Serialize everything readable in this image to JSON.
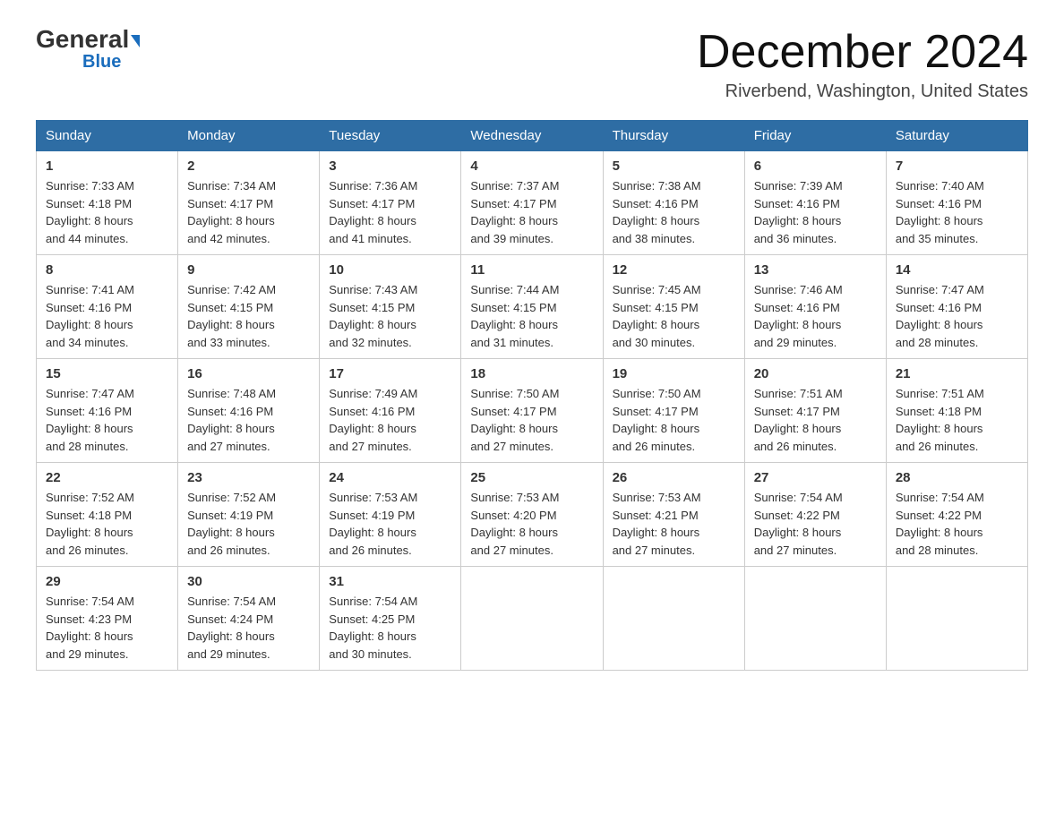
{
  "logo": {
    "line1_black": "General",
    "line1_blue": "Blue",
    "line2": "Blue"
  },
  "header": {
    "month_year": "December 2024",
    "location": "Riverbend, Washington, United States"
  },
  "days_of_week": [
    "Sunday",
    "Monday",
    "Tuesday",
    "Wednesday",
    "Thursday",
    "Friday",
    "Saturday"
  ],
  "weeks": [
    [
      {
        "day": "1",
        "sunrise": "7:33 AM",
        "sunset": "4:18 PM",
        "daylight": "8 hours and 44 minutes."
      },
      {
        "day": "2",
        "sunrise": "7:34 AM",
        "sunset": "4:17 PM",
        "daylight": "8 hours and 42 minutes."
      },
      {
        "day": "3",
        "sunrise": "7:36 AM",
        "sunset": "4:17 PM",
        "daylight": "8 hours and 41 minutes."
      },
      {
        "day": "4",
        "sunrise": "7:37 AM",
        "sunset": "4:17 PM",
        "daylight": "8 hours and 39 minutes."
      },
      {
        "day": "5",
        "sunrise": "7:38 AM",
        "sunset": "4:16 PM",
        "daylight": "8 hours and 38 minutes."
      },
      {
        "day": "6",
        "sunrise": "7:39 AM",
        "sunset": "4:16 PM",
        "daylight": "8 hours and 36 minutes."
      },
      {
        "day": "7",
        "sunrise": "7:40 AM",
        "sunset": "4:16 PM",
        "daylight": "8 hours and 35 minutes."
      }
    ],
    [
      {
        "day": "8",
        "sunrise": "7:41 AM",
        "sunset": "4:16 PM",
        "daylight": "8 hours and 34 minutes."
      },
      {
        "day": "9",
        "sunrise": "7:42 AM",
        "sunset": "4:15 PM",
        "daylight": "8 hours and 33 minutes."
      },
      {
        "day": "10",
        "sunrise": "7:43 AM",
        "sunset": "4:15 PM",
        "daylight": "8 hours and 32 minutes."
      },
      {
        "day": "11",
        "sunrise": "7:44 AM",
        "sunset": "4:15 PM",
        "daylight": "8 hours and 31 minutes."
      },
      {
        "day": "12",
        "sunrise": "7:45 AM",
        "sunset": "4:15 PM",
        "daylight": "8 hours and 30 minutes."
      },
      {
        "day": "13",
        "sunrise": "7:46 AM",
        "sunset": "4:16 PM",
        "daylight": "8 hours and 29 minutes."
      },
      {
        "day": "14",
        "sunrise": "7:47 AM",
        "sunset": "4:16 PM",
        "daylight": "8 hours and 28 minutes."
      }
    ],
    [
      {
        "day": "15",
        "sunrise": "7:47 AM",
        "sunset": "4:16 PM",
        "daylight": "8 hours and 28 minutes."
      },
      {
        "day": "16",
        "sunrise": "7:48 AM",
        "sunset": "4:16 PM",
        "daylight": "8 hours and 27 minutes."
      },
      {
        "day": "17",
        "sunrise": "7:49 AM",
        "sunset": "4:16 PM",
        "daylight": "8 hours and 27 minutes."
      },
      {
        "day": "18",
        "sunrise": "7:50 AM",
        "sunset": "4:17 PM",
        "daylight": "8 hours and 27 minutes."
      },
      {
        "day": "19",
        "sunrise": "7:50 AM",
        "sunset": "4:17 PM",
        "daylight": "8 hours and 26 minutes."
      },
      {
        "day": "20",
        "sunrise": "7:51 AM",
        "sunset": "4:17 PM",
        "daylight": "8 hours and 26 minutes."
      },
      {
        "day": "21",
        "sunrise": "7:51 AM",
        "sunset": "4:18 PM",
        "daylight": "8 hours and 26 minutes."
      }
    ],
    [
      {
        "day": "22",
        "sunrise": "7:52 AM",
        "sunset": "4:18 PM",
        "daylight": "8 hours and 26 minutes."
      },
      {
        "day": "23",
        "sunrise": "7:52 AM",
        "sunset": "4:19 PM",
        "daylight": "8 hours and 26 minutes."
      },
      {
        "day": "24",
        "sunrise": "7:53 AM",
        "sunset": "4:19 PM",
        "daylight": "8 hours and 26 minutes."
      },
      {
        "day": "25",
        "sunrise": "7:53 AM",
        "sunset": "4:20 PM",
        "daylight": "8 hours and 27 minutes."
      },
      {
        "day": "26",
        "sunrise": "7:53 AM",
        "sunset": "4:21 PM",
        "daylight": "8 hours and 27 minutes."
      },
      {
        "day": "27",
        "sunrise": "7:54 AM",
        "sunset": "4:22 PM",
        "daylight": "8 hours and 27 minutes."
      },
      {
        "day": "28",
        "sunrise": "7:54 AM",
        "sunset": "4:22 PM",
        "daylight": "8 hours and 28 minutes."
      }
    ],
    [
      {
        "day": "29",
        "sunrise": "7:54 AM",
        "sunset": "4:23 PM",
        "daylight": "8 hours and 29 minutes."
      },
      {
        "day": "30",
        "sunrise": "7:54 AM",
        "sunset": "4:24 PM",
        "daylight": "8 hours and 29 minutes."
      },
      {
        "day": "31",
        "sunrise": "7:54 AM",
        "sunset": "4:25 PM",
        "daylight": "8 hours and 30 minutes."
      },
      null,
      null,
      null,
      null
    ]
  ],
  "labels": {
    "sunrise": "Sunrise:",
    "sunset": "Sunset:",
    "daylight": "Daylight:"
  }
}
